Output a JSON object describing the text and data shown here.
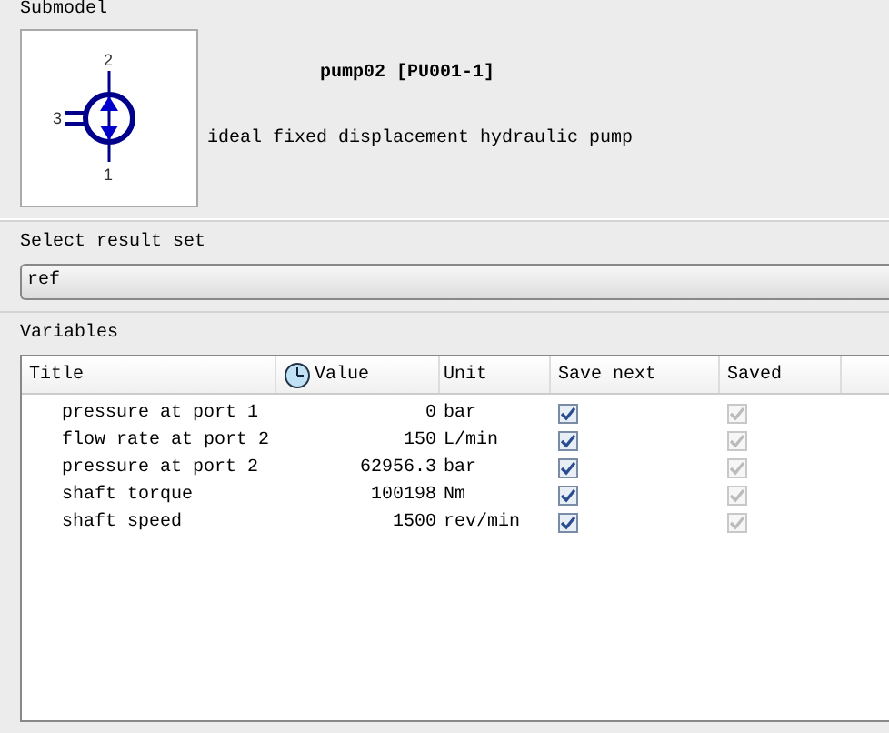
{
  "submodel": {
    "label": "Submodel",
    "ports": [
      "2",
      "3",
      "1"
    ],
    "name": "pump02 [PU001-1]",
    "description": "ideal fixed displacement hydraulic pump"
  },
  "result_set": {
    "label": "Select result set",
    "value": "ref"
  },
  "variables": {
    "label": "Variables",
    "columns": [
      "Title",
      "Value",
      "Unit",
      "Save next",
      "Saved"
    ],
    "rows": [
      {
        "title": "pressure at port 1",
        "value": "0",
        "unit": "bar",
        "save_next": {
          "checked": true,
          "disabled": false
        },
        "saved": {
          "checked": true,
          "disabled": true
        }
      },
      {
        "title": "flow rate at port 2",
        "value": "150",
        "unit": "L/min",
        "save_next": {
          "checked": true,
          "disabled": false
        },
        "saved": {
          "checked": true,
          "disabled": true
        }
      },
      {
        "title": "pressure at port 2",
        "value": "62956.3",
        "unit": "bar",
        "save_next": {
          "checked": true,
          "disabled": false
        },
        "saved": {
          "checked": true,
          "disabled": true
        }
      },
      {
        "title": "shaft torque",
        "value": "100198",
        "unit": "Nm",
        "save_next": {
          "checked": true,
          "disabled": false
        },
        "saved": {
          "checked": true,
          "disabled": true
        }
      },
      {
        "title": "shaft speed",
        "value": "1500",
        "unit": "rev/min",
        "save_next": {
          "checked": true,
          "disabled": false
        },
        "saved": {
          "checked": true,
          "disabled": true
        }
      }
    ]
  }
}
